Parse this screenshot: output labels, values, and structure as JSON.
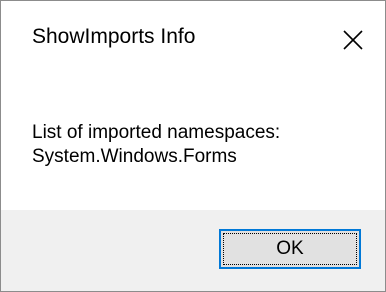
{
  "window": {
    "title": "ShowImports Info",
    "close_icon": "close-icon"
  },
  "message": {
    "line1": "List of imported namespaces:",
    "line2": "System.Windows.Forms"
  },
  "buttons": {
    "ok_label": "OK"
  },
  "colors": {
    "footer_bg": "#f0f0f0",
    "button_bg": "#e1e1e1",
    "button_focus_border": "#0078d7",
    "window_border": "#8c8c8c"
  }
}
